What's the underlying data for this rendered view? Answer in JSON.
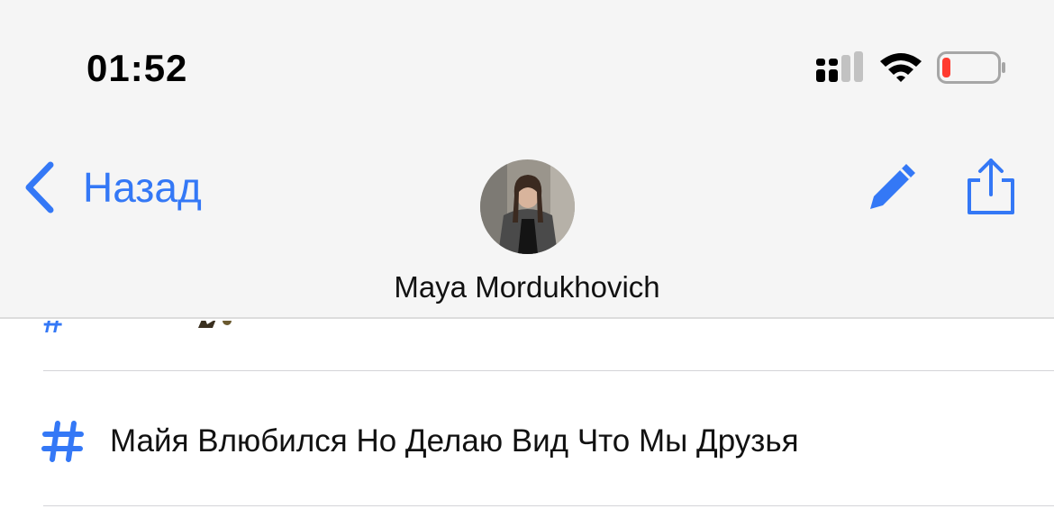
{
  "status_bar": {
    "time": "01:52",
    "battery_color": "#ff3b30"
  },
  "nav": {
    "back_label": "Назад",
    "contact_name": "Maya Mordukhovich",
    "accent_color": "#3478f6",
    "edit_icon": "pencil-icon",
    "share_icon": "share-icon"
  },
  "list": {
    "items": [
      {
        "icon": "hashtag-icon",
        "label": "Майя Влюбился Но Делаю Вид Что Мы Друзья"
      }
    ]
  }
}
